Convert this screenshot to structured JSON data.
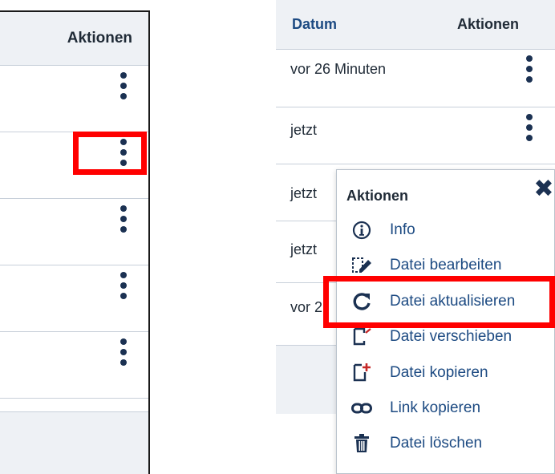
{
  "left_table": {
    "header": "Aktionen",
    "rows": 5
  },
  "right_table": {
    "headers": [
      "Datum",
      "Aktionen"
    ],
    "rows": [
      {
        "date": "vor 26 Minuten"
      },
      {
        "date": "jetzt"
      },
      {
        "date": "jetzt"
      },
      {
        "date": "jetzt"
      },
      {
        "date": "vor 2"
      }
    ]
  },
  "menu": {
    "title": "Aktionen",
    "close_icon": "close-x-icon",
    "items": [
      {
        "label": "Info",
        "icon": "info-circle-icon"
      },
      {
        "label": "Datei bearbeiten",
        "icon": "edit-file-icon"
      },
      {
        "label": "Datei aktualisieren",
        "icon": "refresh-icon"
      },
      {
        "label": "Datei verschieben",
        "icon": "move-file-icon"
      },
      {
        "label": "Datei kopieren",
        "icon": "copy-file-icon"
      },
      {
        "label": "Link kopieren",
        "icon": "link-icon"
      },
      {
        "label": "Datei löschen",
        "icon": "trash-icon"
      }
    ]
  },
  "colors": {
    "accent": "#1c4a82",
    "icon": "#1b3152",
    "header_bg": "#eef1f5",
    "highlight": "#ff0000"
  }
}
